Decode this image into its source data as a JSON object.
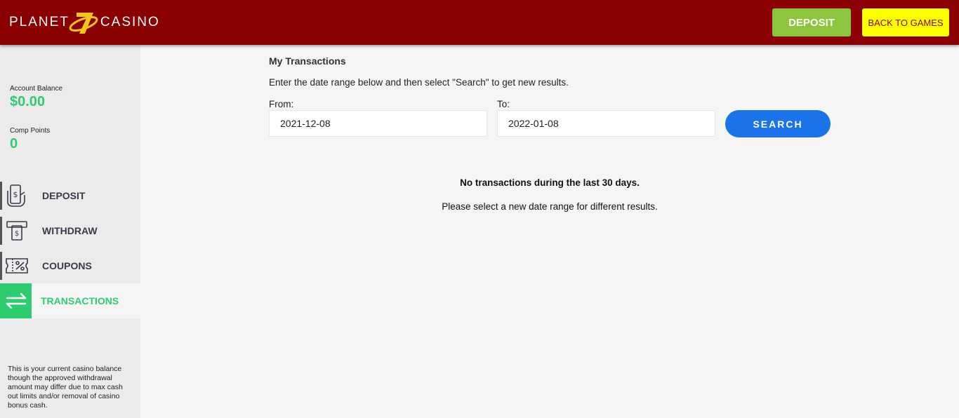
{
  "header": {
    "logo_left": "PLANET",
    "logo_right": "CASINO",
    "deposit_label": "DEPOSIT",
    "back_label": "BACK TO GAMES",
    "colors": {
      "bar": "#8b0000",
      "deposit": "#8cc63f",
      "back": "#ffff00"
    }
  },
  "sidebar": {
    "balance_label": "Account Balance",
    "balance_value": "$0.00",
    "comp_label": "Comp Points",
    "comp_value": "0",
    "items": [
      {
        "label": "DEPOSIT",
        "icon": "deposit-card-icon"
      },
      {
        "label": "WITHDRAW",
        "icon": "atm-withdraw-icon"
      },
      {
        "label": "COUPONS",
        "icon": "coupon-ticket-icon"
      },
      {
        "label": "TRANSACTIONS",
        "icon": "arrows-exchange-icon",
        "active": true
      }
    ],
    "note": "This is your current casino balance though the approved withdrawal amount may differ due to max cash out limits and/or removal of casino bonus cash.",
    "accent": "#2ecc71"
  },
  "main": {
    "title": "My Transactions",
    "instructions": "Enter the date range below and then select \"Search\" to get new results.",
    "from_label": "From:",
    "from_value": "2021-12-08",
    "to_label": "To:",
    "to_value": "2022-01-08",
    "search_label": "SEARCH",
    "no_transactions": "No transactions during the last 30 days.",
    "select_new_range": "Please select a new date range for different results.",
    "search_color": "#1a73e8"
  }
}
